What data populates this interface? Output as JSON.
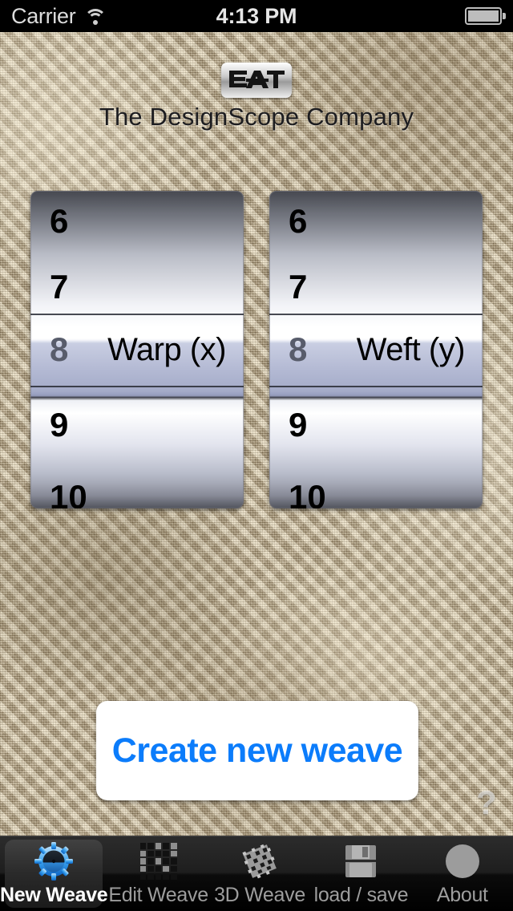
{
  "status_bar": {
    "carrier": "Carrier",
    "time": "4:13 PM",
    "wifi_icon": "wifi-icon",
    "battery_icon": "battery-icon"
  },
  "header": {
    "logo_text": "EAT",
    "logo_icon": "eat-logo-icon",
    "company_name": "The DesignScope Company"
  },
  "pickers": [
    {
      "name": "warp",
      "label": "Warp (x)",
      "selected_value": "8",
      "visible_values": [
        "6",
        "7",
        "8",
        "9",
        "10"
      ],
      "rows": [
        {
          "value": "6"
        },
        {
          "value": "7"
        },
        {
          "value": "8"
        },
        {
          "value": "9"
        },
        {
          "value": "10"
        }
      ]
    },
    {
      "name": "weft",
      "label": "Weft (y)",
      "selected_value": "8",
      "visible_values": [
        "6",
        "7",
        "8",
        "9",
        "10"
      ],
      "rows": [
        {
          "value": "6"
        },
        {
          "value": "7"
        },
        {
          "value": "8"
        },
        {
          "value": "9"
        },
        {
          "value": "10"
        }
      ]
    }
  ],
  "actions": {
    "create_button_label": "Create new weave",
    "create_button_color": "#0b7cfb",
    "help_label": "?"
  },
  "tabbar": {
    "active_index": 0,
    "items": [
      {
        "label": "New Weave",
        "icon": "gear-icon",
        "active": true
      },
      {
        "label": "Edit Weave",
        "icon": "grid-icon",
        "active": false
      },
      {
        "label": "3D Weave",
        "icon": "weave-3d-icon",
        "active": false
      },
      {
        "label": "load / save",
        "icon": "floppy-disk-icon",
        "active": false
      },
      {
        "label": "About",
        "icon": "circle-icon",
        "active": false
      }
    ]
  },
  "theme": {
    "background_fabric": "#c4b18e",
    "accent_blue": "#0b7cfb",
    "selection_band": "#b4bad4",
    "tabbar_background": "#1e1e1e"
  }
}
